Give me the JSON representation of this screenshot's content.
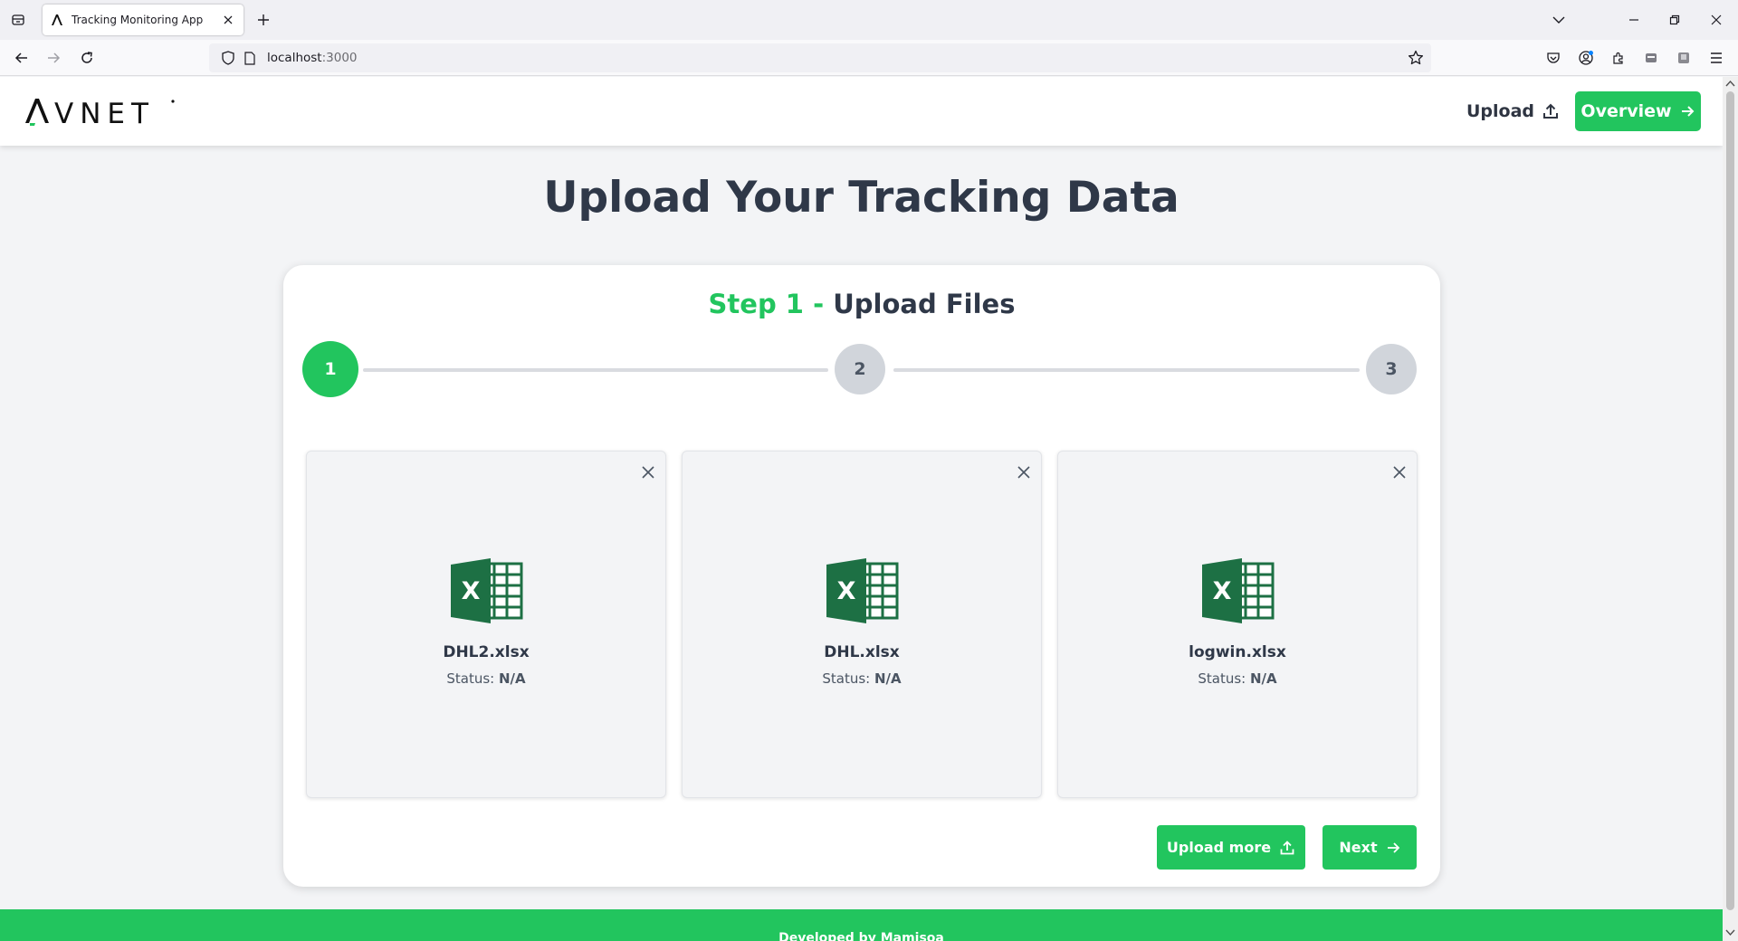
{
  "browser": {
    "tab_title": "Tracking Monitoring App",
    "url_host": "localhost",
    "url_port": ":3000",
    "icons": [
      "tab-list-icon",
      "close-icon",
      "plus-icon",
      "chevron-down-icon",
      "minimize-icon",
      "restore-icon",
      "close-window-icon",
      "back-icon",
      "forward-icon",
      "reload-icon",
      "shield-icon",
      "page-icon",
      "star-icon",
      "pocket-icon",
      "account-icon",
      "extensions-icon",
      "container-icon",
      "profile-icon",
      "menu-icon"
    ]
  },
  "header": {
    "logo": "AVNET",
    "upload_label": "Upload",
    "overview_label": "Overview"
  },
  "page": {
    "title": "Upload Your Tracking Data"
  },
  "wizard": {
    "step_prefix": "Step 1 -",
    "step_name": "Upload Files",
    "steps": [
      "1",
      "2",
      "3"
    ],
    "current_step": 1
  },
  "files": [
    {
      "name": "DHL2.xlsx",
      "status_label": "Status:",
      "status_value": "N/A"
    },
    {
      "name": "DHL.xlsx",
      "status_label": "Status:",
      "status_value": "N/A"
    },
    {
      "name": "logwin.xlsx",
      "status_label": "Status:",
      "status_value": "N/A"
    }
  ],
  "actions": {
    "upload_more_label": "Upload more",
    "next_label": "Next"
  },
  "footer": {
    "text": "Developed by Mamisoa"
  },
  "colors": {
    "accent": "#22c55e",
    "title_text": "#2f3848",
    "excel_green": "#1d7044"
  }
}
